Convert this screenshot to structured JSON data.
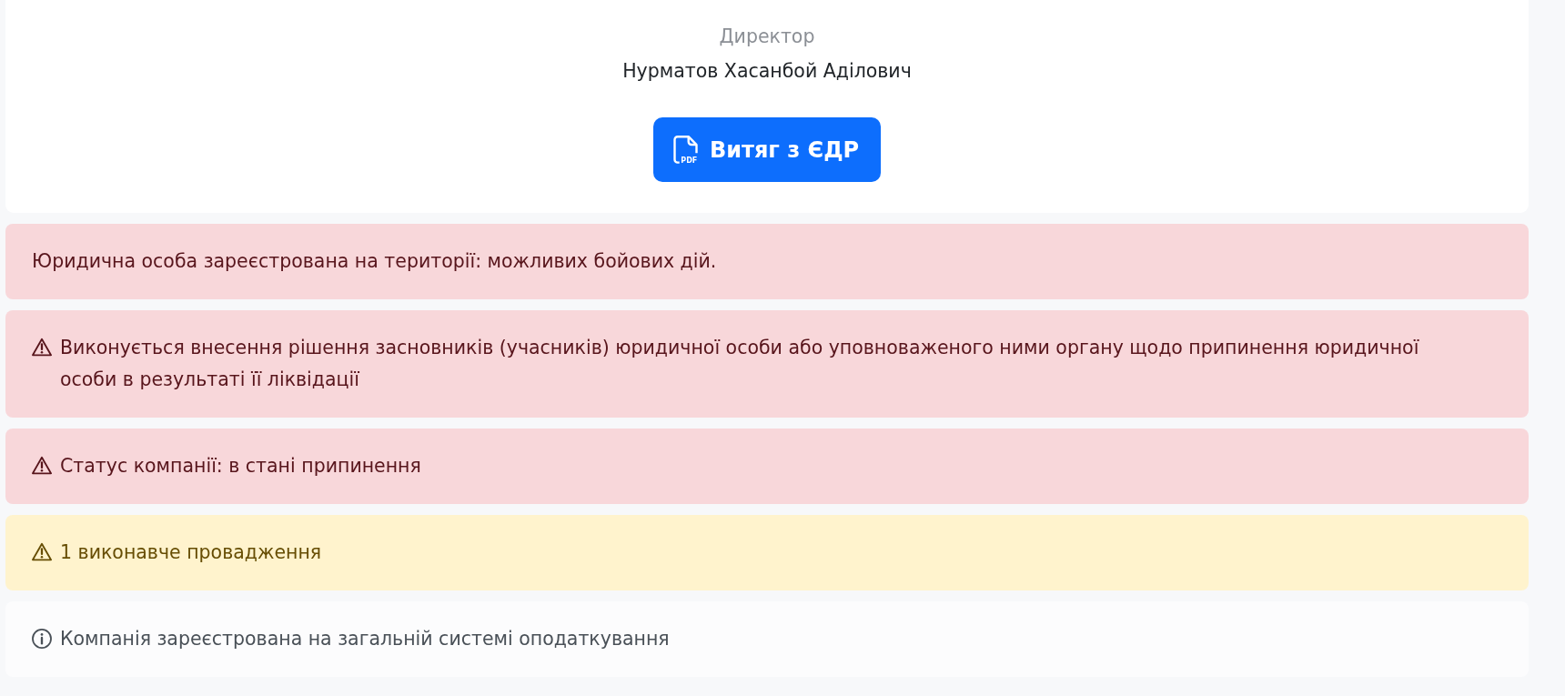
{
  "card": {
    "role": "Директор",
    "director_name": "Нурматов Хасанбой Аділович",
    "button": {
      "icon_text": "PDF",
      "label": "Витяг з ЄДР"
    }
  },
  "alerts": [
    {
      "kind": "notice",
      "text": "Юридична особа зареєстрована на території: можливих бойових дій."
    },
    {
      "kind": "danger",
      "text": "Виконується внесення рішення засновників (учасників) юридичної особи або уповноваженого ними органу щодо припинення юридичної особи в результаті її ліквідації"
    },
    {
      "kind": "danger",
      "text": "Статус компанії: в стані припинення"
    },
    {
      "kind": "warning",
      "text": "1 виконавче провадження"
    },
    {
      "kind": "info",
      "text": "Компанія зареєстрована на загальній системі оподаткування"
    }
  ]
}
